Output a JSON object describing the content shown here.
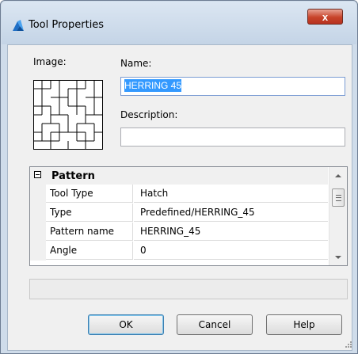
{
  "window": {
    "title": "Tool Properties",
    "close_label": "x"
  },
  "form": {
    "image_label": "Image:",
    "name_label": "Name:",
    "name_value": "HERRING 45",
    "description_label": "Description:",
    "description_value": ""
  },
  "properties": {
    "category": "Pattern",
    "rows": [
      {
        "name": "Tool Type",
        "value": "Hatch"
      },
      {
        "name": "Type",
        "value": "Predefined/HERRING_45"
      },
      {
        "name": "Pattern name",
        "value": "HERRING_45"
      },
      {
        "name": "Angle",
        "value": "0"
      }
    ]
  },
  "buttons": {
    "ok": "OK",
    "cancel": "Cancel",
    "help": "Help"
  },
  "icons": {
    "app": "bricscad-logo-icon",
    "preview": "herringbone-hatch-pattern"
  },
  "colors": {
    "selection": "#3399ff",
    "close_button": "#c7432a",
    "frame": "#cfdcea"
  }
}
